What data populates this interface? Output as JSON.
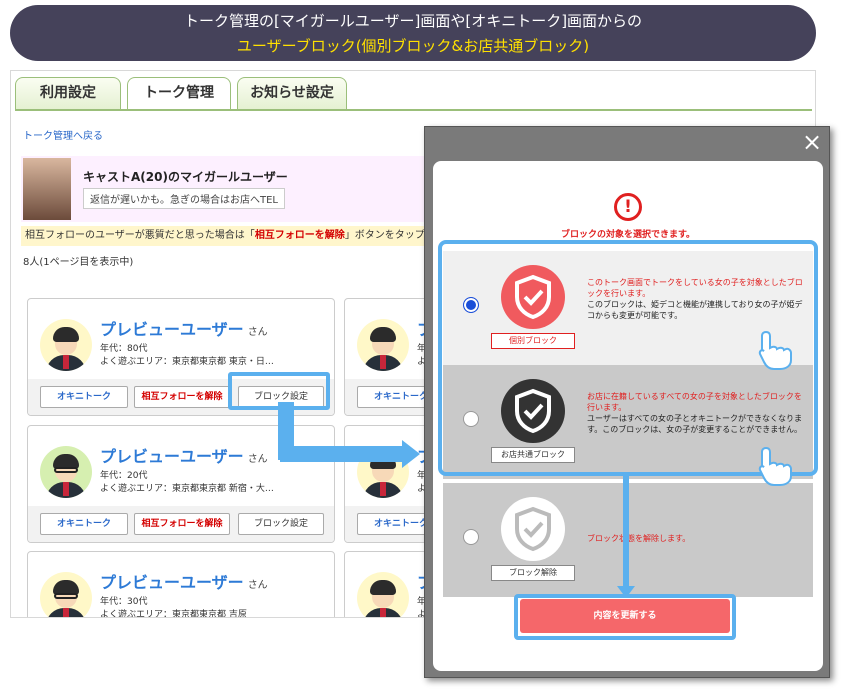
{
  "banner": {
    "line1": "トーク管理の[マイガールユーザー]画面や[オキニトーク]画面からの",
    "line2": "ユーザーブロック(個別ブロック&お店共通ブロック)"
  },
  "tabs": [
    {
      "label": "利用設定"
    },
    {
      "label": "トーク管理"
    },
    {
      "label": "お知らせ設定"
    }
  ],
  "back_link": "トーク管理へ戻る",
  "profile": {
    "name": "キャストA(20)のマイガールユーザー",
    "message": "返信が遅いかも。急ぎの場合はお店へTEL"
  },
  "notice": {
    "prefix": "相互フォローのユーザーが悪質だと思った場合は「",
    "highlight": "相互フォローを解除",
    "suffix": "」ボタンをタップ"
  },
  "count_text": "8人(1ページ目を表示中)",
  "cards": [
    {
      "name": "プレビューユーザー",
      "san": "さん",
      "age": "年代：80代",
      "area": "よく遊ぶエリア：東京都東京都 東京・日…"
    },
    {
      "name": "プレビューユーザー",
      "san": "さん",
      "age": "年代：20代",
      "area": "よく遊ぶエリア：東京都東京都 新宿・大…"
    },
    {
      "name": "プレビューユーザー",
      "san": "さん",
      "age": "年代：30代",
      "area": "よく遊ぶエリア：東京都東京都 吉原"
    }
  ],
  "right_cards": [
    {
      "name": "プ",
      "age": "年代",
      "area": "よく"
    },
    {
      "name": "プ",
      "age": "年代",
      "area": "よく"
    },
    {
      "name": "プ",
      "age": "年代",
      "area": "よく"
    }
  ],
  "buttons": {
    "okini": "オキニトーク",
    "unfollow": "相互フォローを解除",
    "block": "ブロック設定"
  },
  "modal": {
    "close": "×",
    "warn": "!",
    "title": "ブロックの対象を選択できます。",
    "options": [
      {
        "label": "個別ブロック",
        "title": "このトーク画面でトークをしている女の子を対象としたブロックを行います。",
        "desc": "このブロックは、姫デコと機能が連携しており女の子が姫デコからも変更が可能です。",
        "selected": true
      },
      {
        "label": "お店共通ブロック",
        "title": "お店に在籍しているすべての女の子を対象としたブロックを行います。",
        "desc": "ユーザーはすべての女の子とオキニトークができなくなります。このブロックは、女の子が変更することができません。",
        "selected": false
      },
      {
        "label": "ブロック解除",
        "title": "ブロック状態を解除します。",
        "desc": "",
        "selected": false
      }
    ],
    "update_button": "内容を更新する"
  },
  "colors": {
    "accent_blue": "#5bb0ee",
    "red": "#e02020",
    "update_button": "#f5676a",
    "banner_bg": "#45425a",
    "banner_highlight": "#ffe000"
  }
}
